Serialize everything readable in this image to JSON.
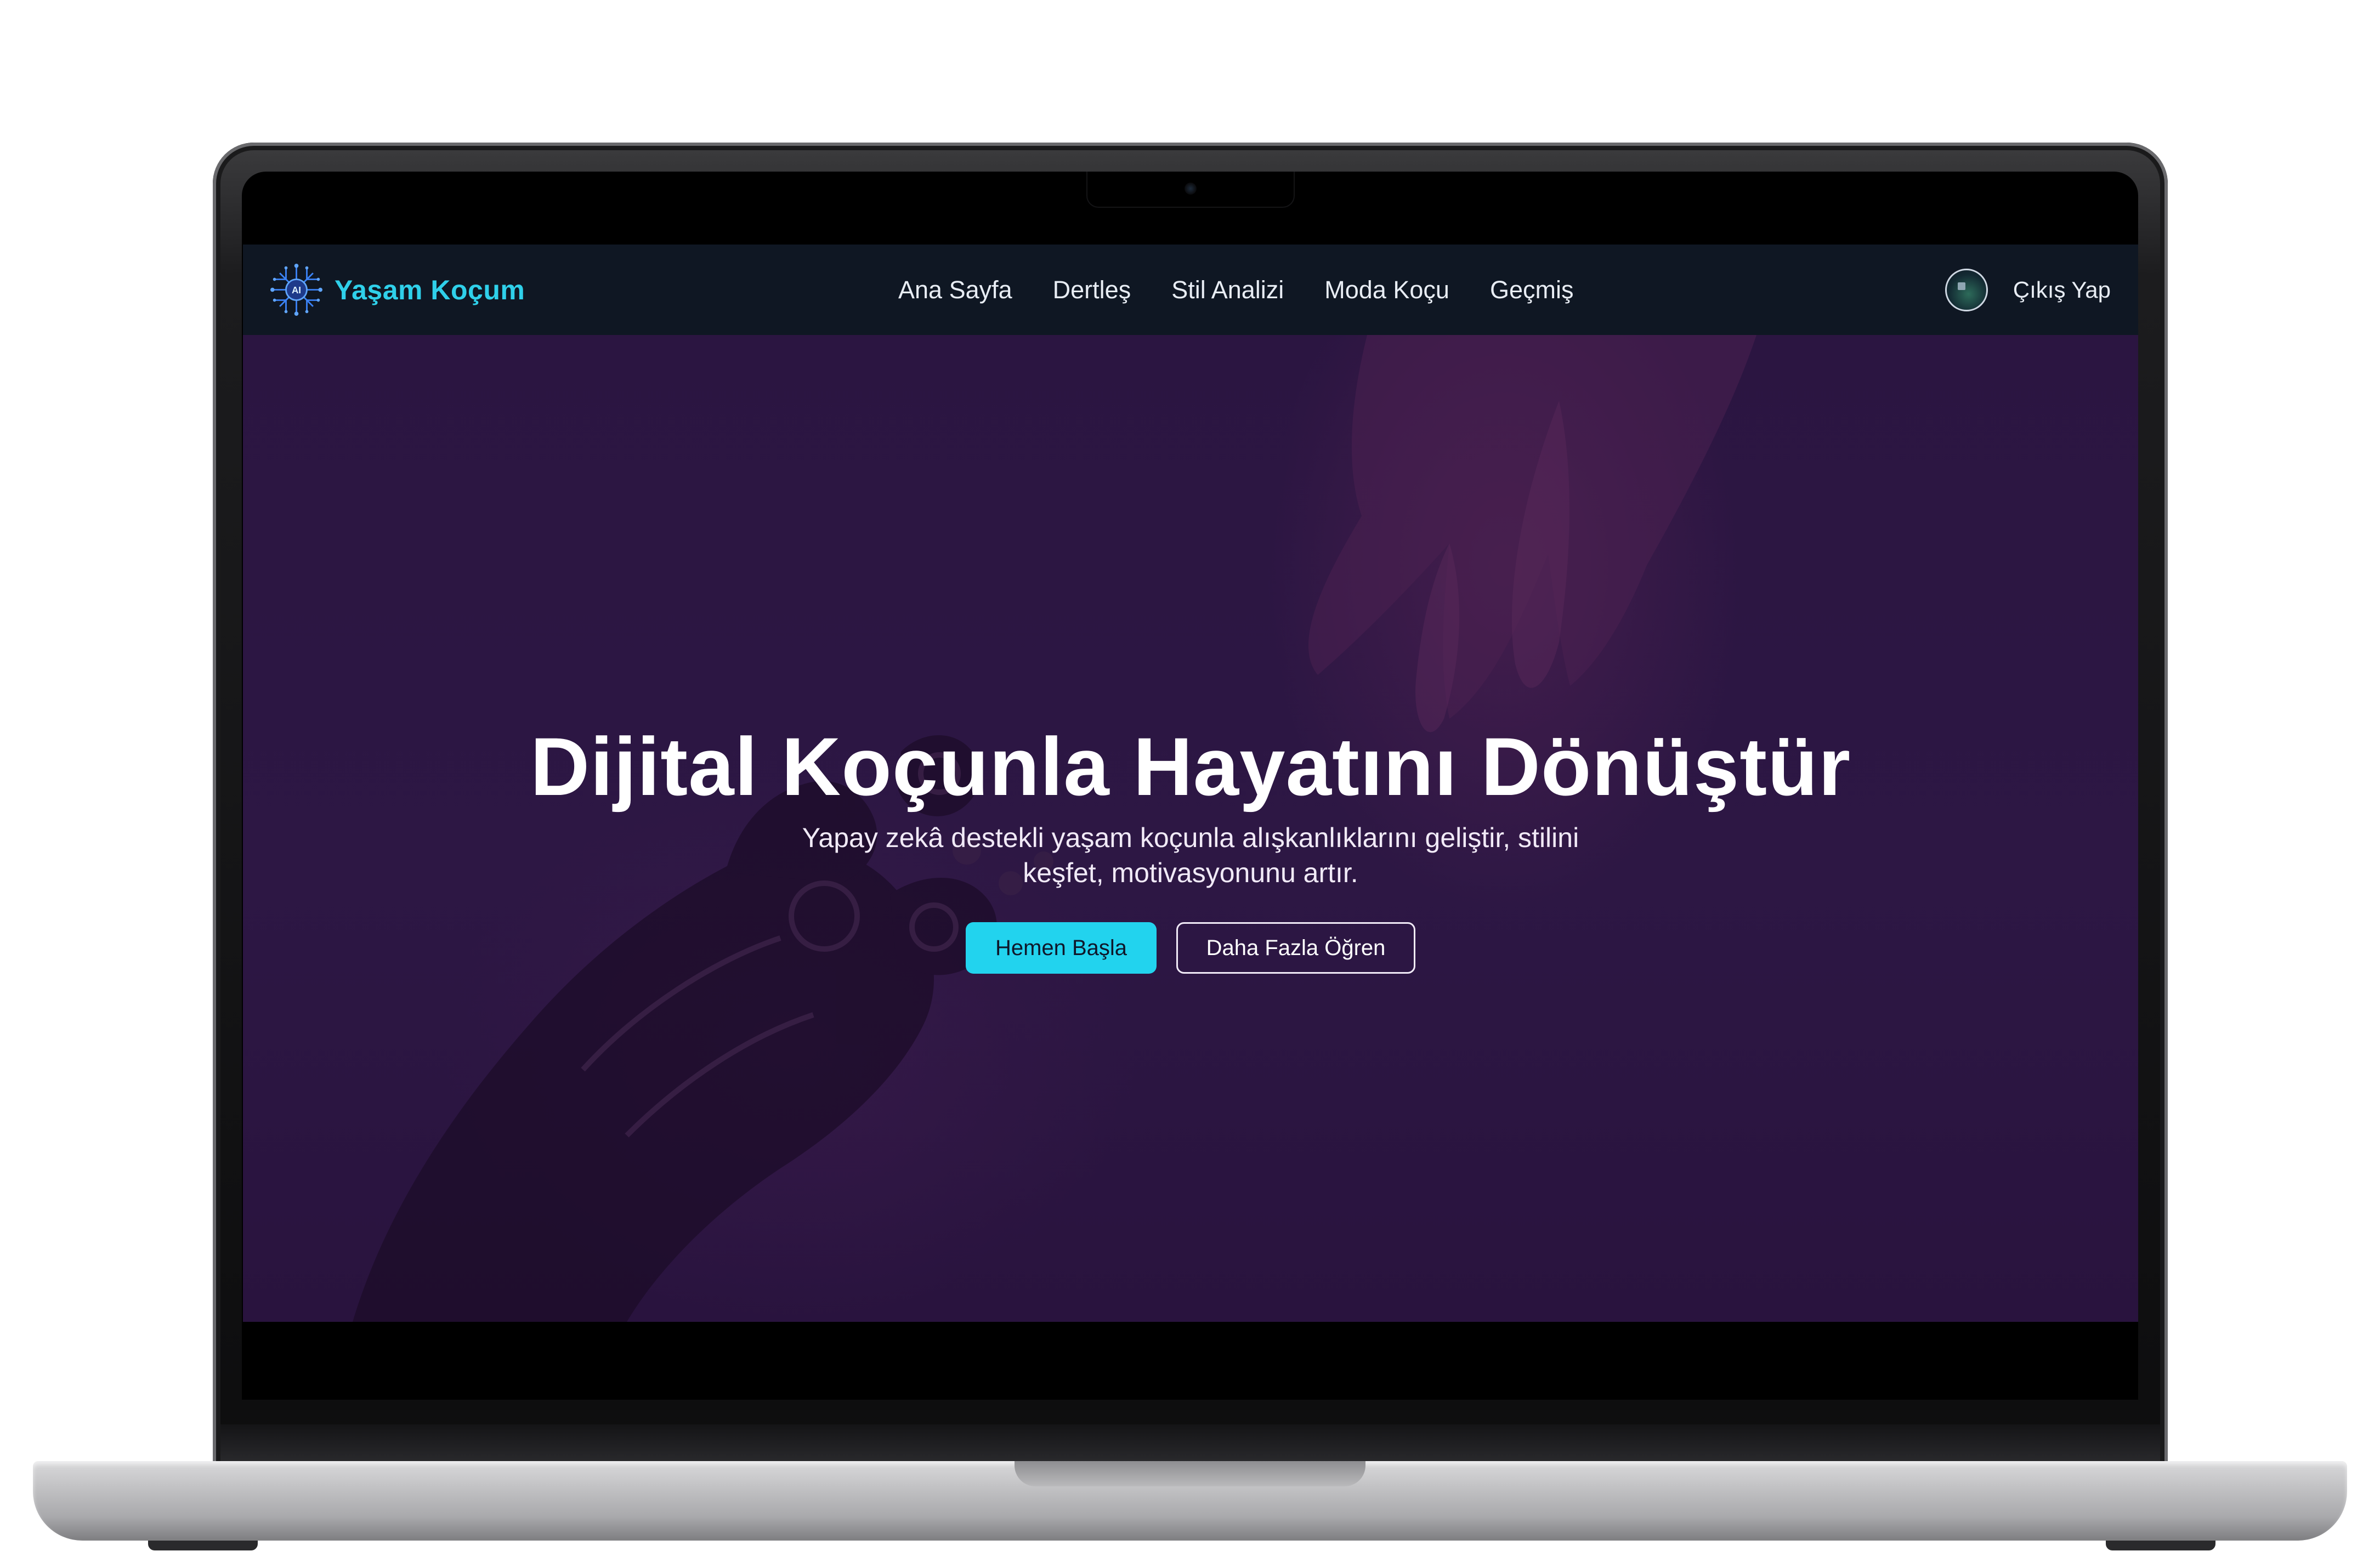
{
  "brand": {
    "name": "Yaşam Koçum",
    "icon": "ai-chip-icon",
    "icon_text": "AI",
    "accent_color": "#2fd0ea"
  },
  "nav": {
    "items": [
      {
        "label": "Ana Sayfa"
      },
      {
        "label": "Dertleş"
      },
      {
        "label": "Stil Analizi"
      },
      {
        "label": "Moda Koçu"
      },
      {
        "label": "Geçmiş"
      }
    ],
    "logout_label": "Çıkış Yap",
    "avatar_icon": "user-avatar"
  },
  "hero": {
    "title": "Dijital Koçunla Hayatını Dönüştür",
    "subtitle": "Yapay zekâ destekli yaşam koçunla alışkanlıklarını geliştir, stilini keşfet, motivasyonunu artır.",
    "primary_button": "Hemen Başla",
    "secondary_button": "Daha Fazla Öğren",
    "primary_color": "#22d3ee",
    "background_color": "#2b1541"
  }
}
